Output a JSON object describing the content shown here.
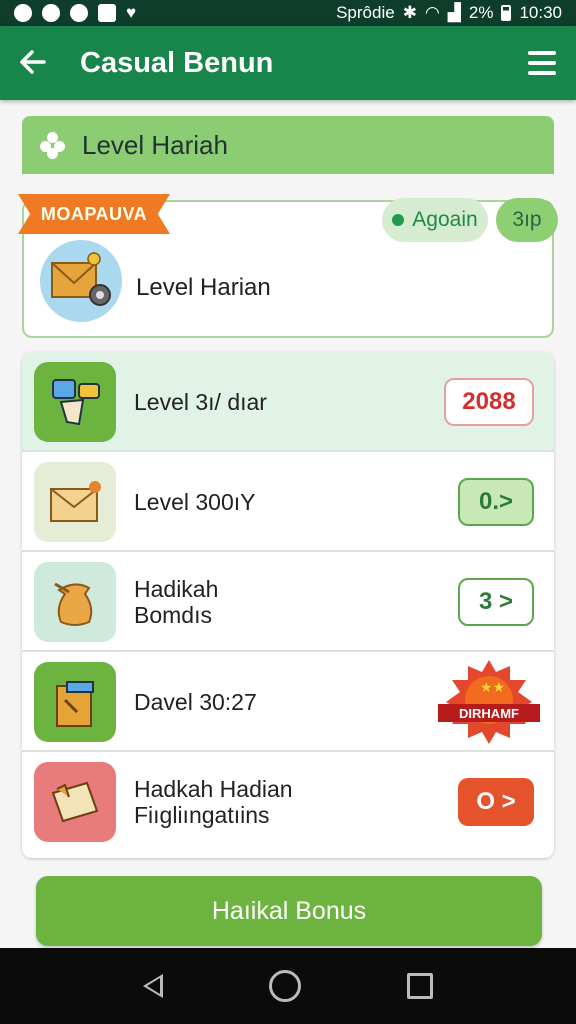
{
  "status_bar": {
    "text": "Sprôdie",
    "battery": "2%",
    "time": "10:30"
  },
  "app_bar": {
    "title": "Casual Benun"
  },
  "section": {
    "title": "Level Hariah"
  },
  "featured": {
    "ribbon": "MOAPAUVA",
    "label": "Level Harian",
    "again_label": "Agoain",
    "points_label": "3ıp"
  },
  "rows": [
    {
      "label": "Level 3ı/ dıar",
      "badge": "2088",
      "icon": "puzzle-pieces-icon"
    },
    {
      "label": "Level 300ıY",
      "badge": "0.>",
      "icon": "envelope-icon"
    },
    {
      "label_line1": "Hadikah",
      "label_line2": "Bomdıs",
      "badge": "3 >",
      "icon": "sack-icon"
    },
    {
      "label": "Davel 30:27",
      "badge": "DIRHAMF",
      "icon": "gift-box-icon"
    },
    {
      "label_line1": "Hadkah Hadian",
      "label_line2": "Fiıgliıngatıins",
      "badge": "O >",
      "icon": "ticket-icon"
    }
  ],
  "bonus_button": {
    "label": "Haıikal Bonus"
  },
  "colors": {
    "app_bar": "#18864a",
    "header": "#8ccc72",
    "accent_red": "#e4532c",
    "button": "#6cb43f"
  }
}
